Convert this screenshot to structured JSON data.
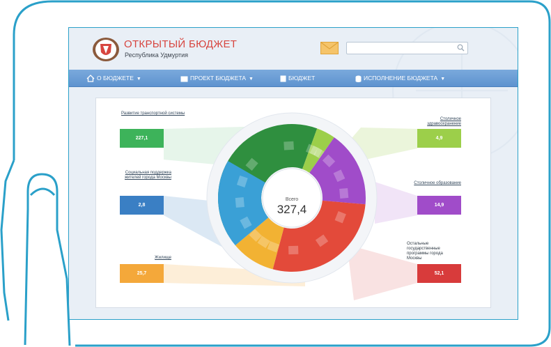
{
  "header": {
    "title": "ОТКРЫТЫЙ БЮДЖЕТ",
    "subtitle": "Республика Удмуртия",
    "search_placeholder": ""
  },
  "nav": {
    "items": [
      {
        "label": "О БЮДЖЕТЕ",
        "icon": "home-icon",
        "has_dropdown": true
      },
      {
        "label": "ПРОЕКТ БЮДЖЕТА",
        "icon": "wallet-icon",
        "has_dropdown": true
      },
      {
        "label": "БЮДЖЕТ",
        "icon": "document-icon",
        "has_dropdown": false
      },
      {
        "label": "ИСПОЛНЕНИЕ БЮДЖЕТА",
        "icon": "coins-icon",
        "has_dropdown": true
      }
    ]
  },
  "budget": {
    "total_label": "Всего",
    "total_value": "327,4",
    "categories": [
      {
        "label": "Развитие транспортной системы",
        "value": "227,1",
        "color": "#3db35a"
      },
      {
        "label": "Социальная поддержка жителей города Москвы",
        "value": "2,8",
        "color": "#3a7fc4"
      },
      {
        "label": "Жилище",
        "value": "25,7",
        "color": "#f4a83a"
      },
      {
        "label": "Столичное здравоохранение",
        "value": "4,9",
        "color": "#9ccf4a"
      },
      {
        "label": "Столичное образование",
        "value": "14,9",
        "color": "#a04cc9"
      },
      {
        "label": "Остальные государственные программы города Москвы",
        "value": "52,1",
        "color": "#d83b3b"
      }
    ]
  },
  "colors": {
    "accent_red": "#d7453f",
    "nav_blue": "#6b9ed6",
    "frame": "#2aa0c9"
  }
}
